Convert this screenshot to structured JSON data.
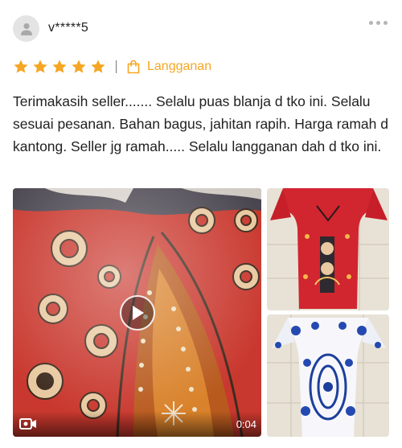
{
  "review": {
    "username": "v*****5",
    "rating": 5,
    "badge_label": "Langganan",
    "comment": "Terimakasih seller....... Selalu puas blanja d tko ini. Selalu sesuai pesanan. Bahan bagus, jahitan rapih. Harga ramah d kantong. Seller jg ramah..... Selalu langganan dah d tko ini."
  },
  "media": {
    "video": {
      "duration": "0:04",
      "icon": "video-camera-icon"
    },
    "images": [
      {
        "name": "red-batik-dress-photo"
      },
      {
        "name": "blue-white-batik-dress-photo"
      }
    ]
  },
  "colors": {
    "star": "#f5a623",
    "badge": "#f5a623",
    "text": "#222222",
    "avatar_bg": "#e4e4e4"
  },
  "icons": {
    "avatar": "user-icon",
    "more": "more-dots-icon",
    "badge": "shopping-bag-icon",
    "play": "play-icon"
  }
}
